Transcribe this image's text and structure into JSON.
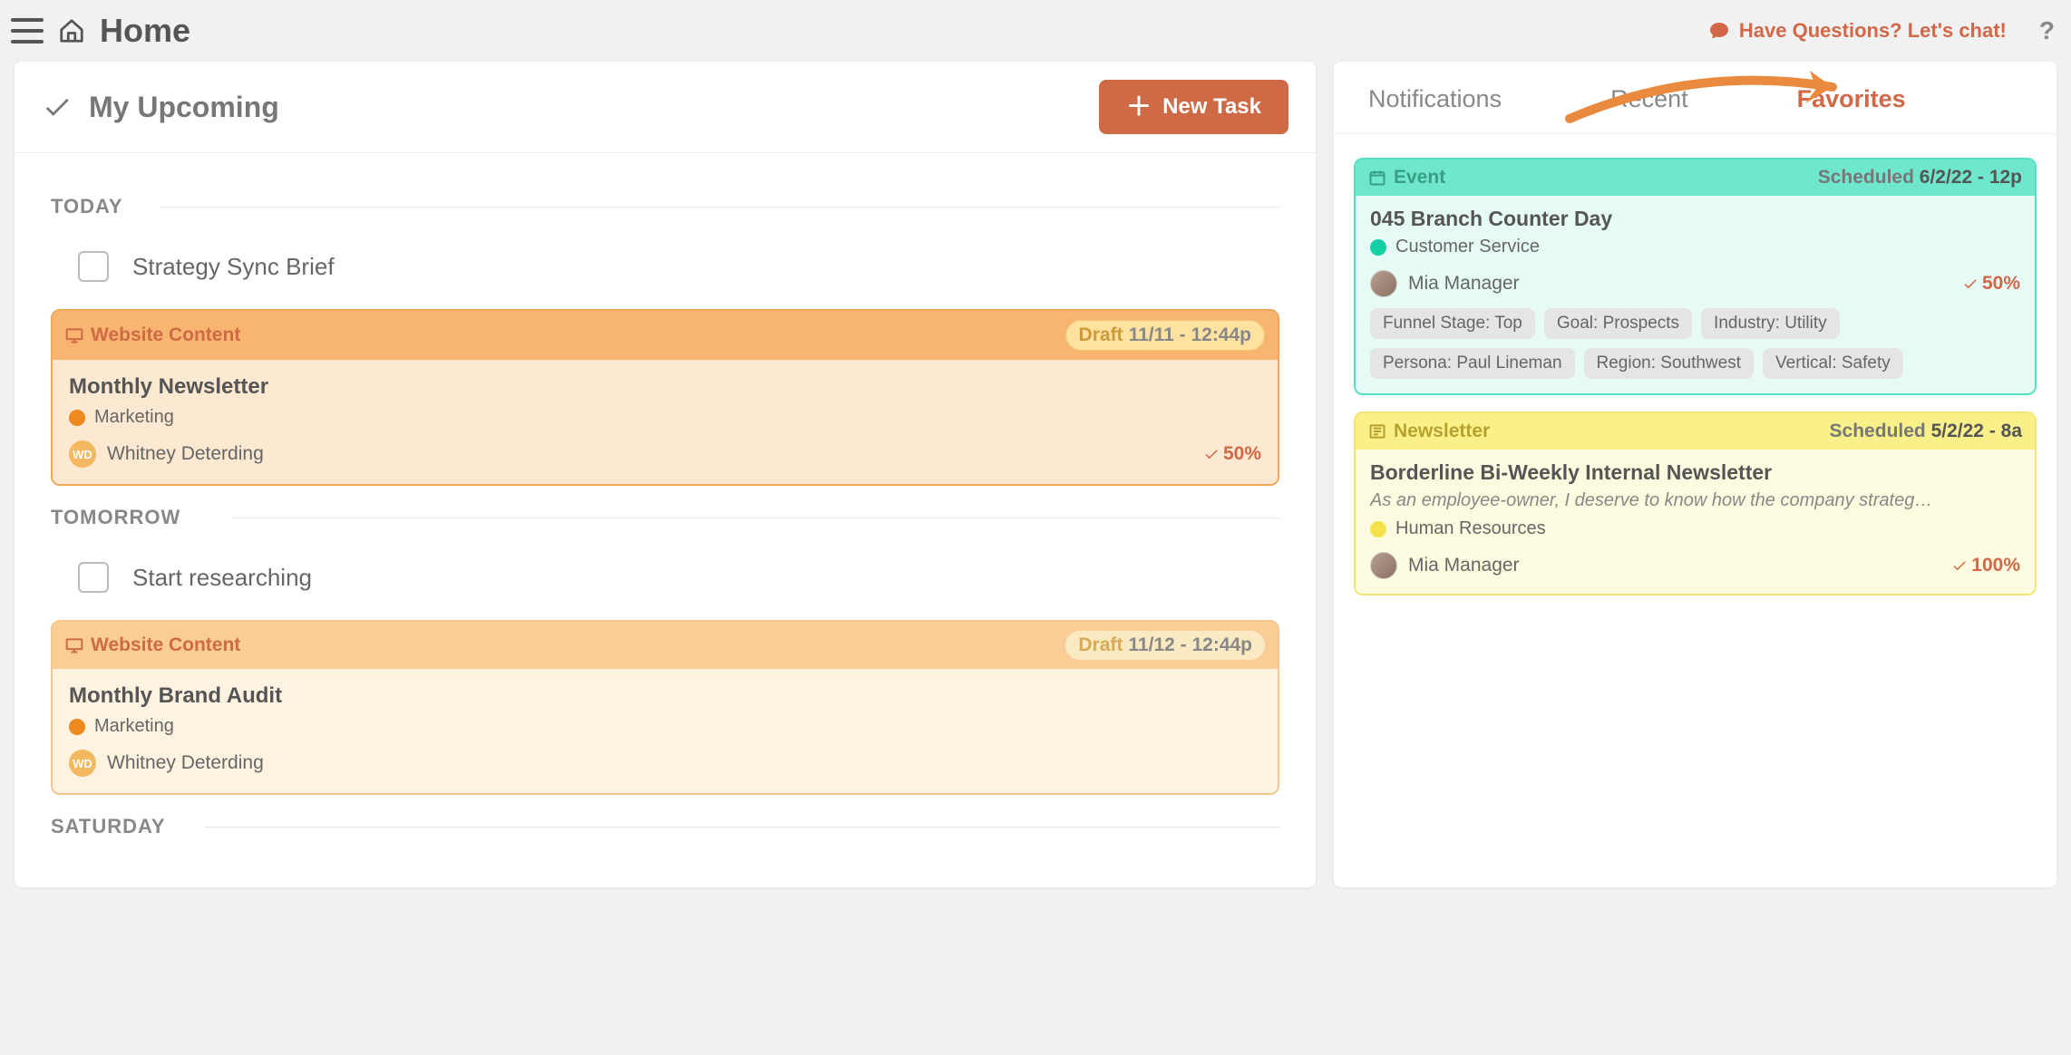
{
  "topbar": {
    "title": "Home",
    "chat_label": "Have Questions? Let's chat!",
    "help_symbol": "?"
  },
  "upcoming": {
    "heading": "My Upcoming",
    "new_task_label": "New Task",
    "days": {
      "today": "TODAY",
      "tomorrow": "TOMORROW",
      "saturday": "SATURDAY"
    },
    "today_task": "Strategy Sync Brief",
    "tomorrow_task": "Start researching",
    "card1": {
      "type_label": "Website Content",
      "status": "Draft",
      "datetime": "11/11 - 12:44p",
      "title": "Monthly Newsletter",
      "category": "Marketing",
      "assignee_initials": "WD",
      "assignee": "Whitney Deterding",
      "progress": "50%"
    },
    "card2": {
      "type_label": "Website Content",
      "status": "Draft",
      "datetime": "11/12 - 12:44p",
      "title": "Monthly Brand Audit",
      "category": "Marketing",
      "assignee_initials": "WD",
      "assignee": "Whitney Deterding"
    }
  },
  "right": {
    "tabs": {
      "notifications": "Notifications",
      "recent": "Recent",
      "favorites": "Favorites"
    },
    "fav1": {
      "type_label": "Event",
      "sched_label": "Scheduled",
      "datetime": "6/2/22 - 12p",
      "title": "045 Branch Counter Day",
      "category": "Customer Service",
      "assignee": "Mia Manager",
      "progress": "50%",
      "tags": [
        "Funnel Stage: Top",
        "Goal: Prospects",
        "Industry: Utility",
        "Persona: Paul Lineman",
        "Region: Southwest",
        "Vertical: Safety"
      ]
    },
    "fav2": {
      "type_label": "Newsletter",
      "sched_label": "Scheduled",
      "datetime": "5/2/22 - 8a",
      "title": "Borderline Bi-Weekly Internal Newsletter",
      "desc": "As an employee-owner, I deserve to know how the company strateg…",
      "category": "Human Resources",
      "assignee": "Mia Manager",
      "progress": "100%"
    }
  }
}
